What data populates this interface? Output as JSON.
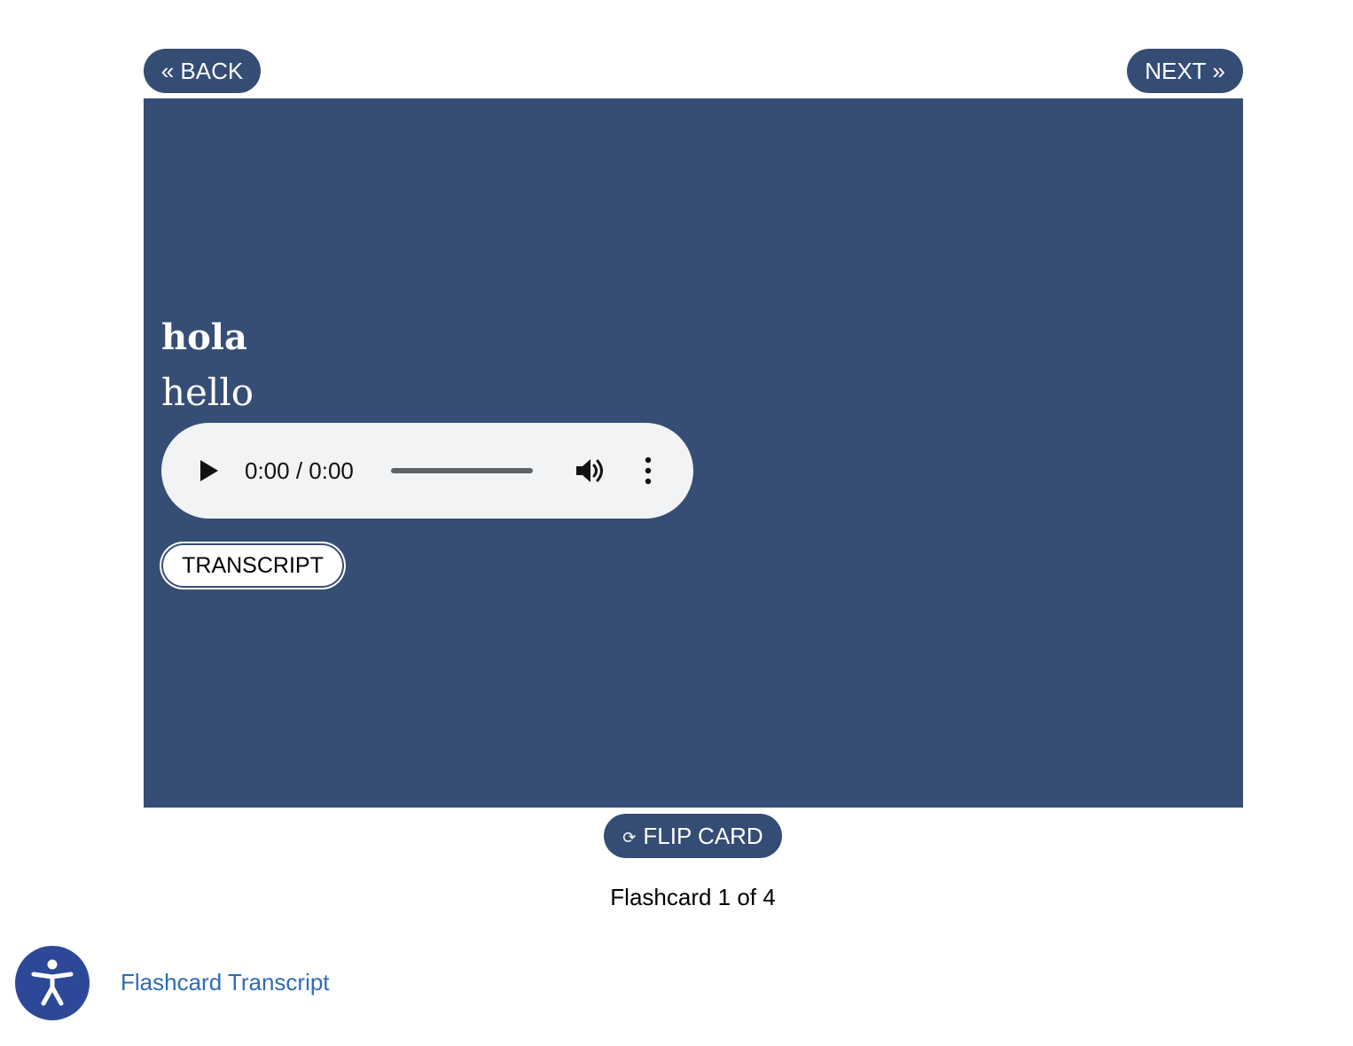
{
  "navigation": {
    "back_label": "« BACK",
    "next_label": "NEXT »"
  },
  "card": {
    "word": "hola",
    "translation": "hello",
    "background_color": "#364e76",
    "audio_player": {
      "time_display": "0:00 / 0:00",
      "progress": 0
    },
    "transcript_button_label": "TRANSCRIPT"
  },
  "flip": {
    "icon": "flip-icon",
    "icon_glyph": "⟳",
    "label": "FLIP CARD"
  },
  "counter_text": "Flashcard 1 of 4",
  "footer": {
    "accessibility_icon": "accessibility-icon",
    "transcript_link_label": "Flashcard Transcript"
  },
  "colors": {
    "button": "#354d75",
    "accessibility": "#2d4896",
    "link": "#2f6bb3",
    "audio_bg": "#f1f3f4"
  }
}
